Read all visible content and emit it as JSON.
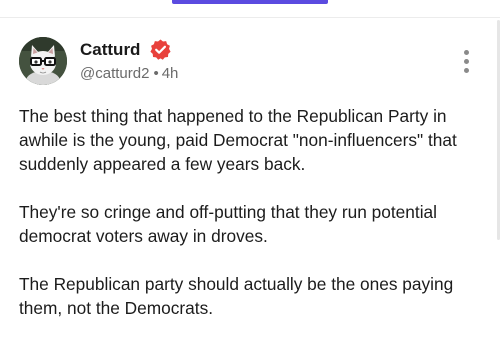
{
  "tabs": {
    "active_color": "#5b4be0"
  },
  "post": {
    "author": {
      "name": "Catturd",
      "handle": "@catturd2",
      "verified": true,
      "verified_badge_color": "#e8413c",
      "avatar": "cat-with-glasses-avatar"
    },
    "separator": "•",
    "time": "4h",
    "more_icon": "vertical-ellipsis-icon",
    "paragraphs": [
      "The best thing that happened to the Republican Party in awhile is the young, paid Democrat \"non-influencers\" that suddenly appeared a few years back.",
      "They're so cringe and off-putting that they run potential democrat voters away in droves.",
      "The Republican party should actually be the ones paying them, not the Democrats."
    ]
  }
}
